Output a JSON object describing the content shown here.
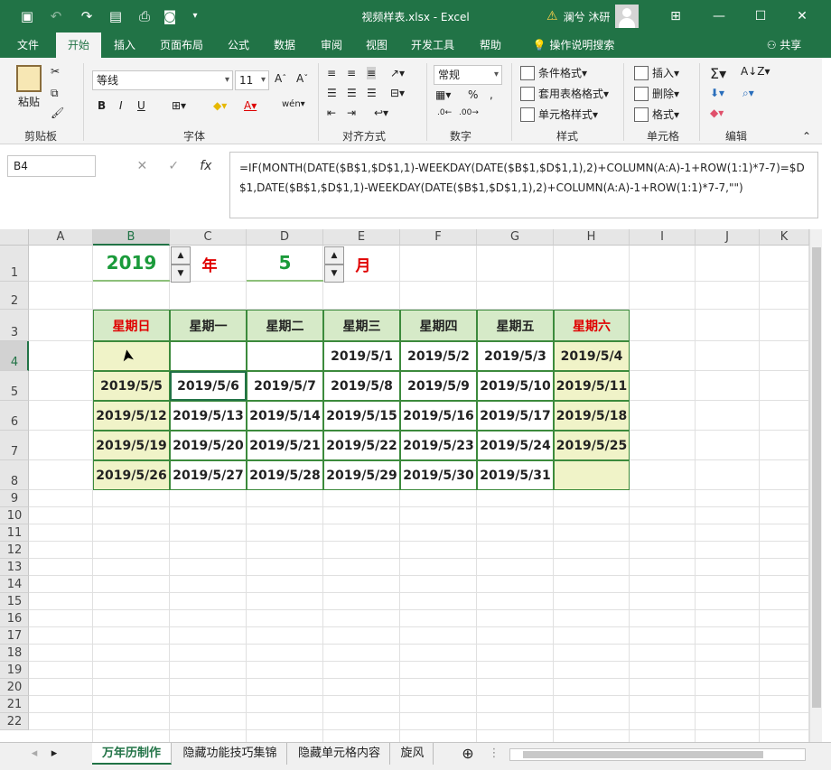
{
  "titlebar": {
    "document_title": "视频样表.xlsx  -  Excel",
    "user_name": "澜兮 沐研",
    "warning_icon": "warning-icon",
    "window_controls": [
      "restore-ribbon-icon",
      "minimize-icon",
      "maximize-icon",
      "close-icon"
    ]
  },
  "tabs": [
    "文件",
    "开始",
    "插入",
    "页面布局",
    "公式",
    "数据",
    "审阅",
    "视图",
    "开发工具",
    "帮助",
    "操作说明搜索",
    "共享"
  ],
  "ribbon": {
    "clipboard": {
      "paste": "粘贴",
      "label": "剪贴板"
    },
    "font": {
      "name": "等线",
      "size": "11",
      "label": "字体",
      "bold": "B",
      "italic": "I",
      "underline": "U"
    },
    "alignment": {
      "label": "对齐方式"
    },
    "number": {
      "format": "常规",
      "label": "数字",
      "percent": "%"
    },
    "styles": {
      "conditional": "条件格式",
      "table": "套用表格格式",
      "cell": "单元格样式",
      "label": "样式"
    },
    "cells": {
      "insert": "插入",
      "delete": "删除",
      "format": "格式",
      "label": "单元格"
    },
    "editing": {
      "label": "编辑"
    }
  },
  "formula_bar": {
    "name_box": "B4",
    "fx": "fx",
    "formula": "=IF(MONTH(DATE($B$1,$D$1,1)-WEEKDAY(DATE($B$1,$D$1,1),2)+COLUMN(A:A)-1+ROW(1:1)*7-7)=$D$1,DATE($B$1,$D$1,1)-WEEKDAY(DATE($B$1,$D$1,1),2)+COLUMN(A:A)-1+ROW(1:1)*7-7,\"\")"
  },
  "sheet": {
    "columns": [
      "A",
      "B",
      "C",
      "D",
      "E",
      "F",
      "G",
      "H",
      "I",
      "J",
      "K"
    ],
    "rows": [
      "1",
      "2",
      "3",
      "4",
      "5",
      "6",
      "7",
      "8",
      "9",
      "10",
      "11",
      "12",
      "13",
      "14",
      "15",
      "16",
      "17",
      "18",
      "19",
      "20",
      "21",
      "22"
    ],
    "year": "2019",
    "year_label": "年",
    "month": "5",
    "month_label": "月",
    "weekdays": [
      "星期日",
      "星期一",
      "星期二",
      "星期三",
      "星期四",
      "星期五",
      "星期六"
    ],
    "calendar": [
      [
        "",
        "",
        "",
        "2019/5/1",
        "2019/5/2",
        "2019/5/3",
        "2019/5/4"
      ],
      [
        "2019/5/5",
        "2019/5/6",
        "2019/5/7",
        "2019/5/8",
        "2019/5/9",
        "2019/5/10",
        "2019/5/11"
      ],
      [
        "2019/5/12",
        "2019/5/13",
        "2019/5/14",
        "2019/5/15",
        "2019/5/16",
        "2019/5/17",
        "2019/5/18"
      ],
      [
        "2019/5/19",
        "2019/5/20",
        "2019/5/21",
        "2019/5/22",
        "2019/5/23",
        "2019/5/24",
        "2019/5/25"
      ],
      [
        "2019/5/26",
        "2019/5/27",
        "2019/5/28",
        "2019/5/29",
        "2019/5/30",
        "2019/5/31",
        ""
      ]
    ],
    "colors": {
      "accent": "#217346",
      "weekend": "#e00000",
      "header_fill": "#d6eac8",
      "weekend_fill": "#f0f3c8",
      "number_green": "#1a9a3a"
    }
  },
  "sheet_tabs": [
    "万年历制作",
    "隐藏功能技巧集锦",
    "隐藏单元格内容",
    "旋风"
  ]
}
